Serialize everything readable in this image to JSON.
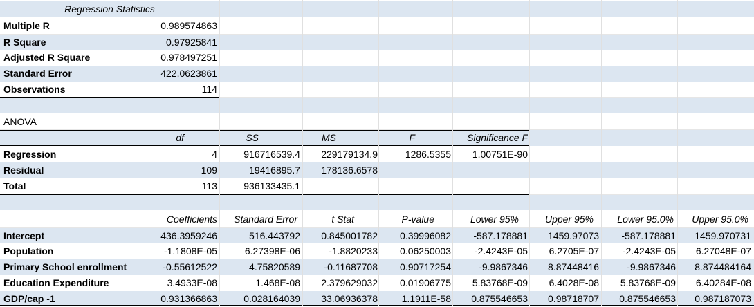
{
  "regression_statistics": {
    "header": "Regression Statistics",
    "rows": [
      {
        "label": "Multiple R",
        "value": "0.989574863"
      },
      {
        "label": "R Square",
        "value": "0.97925841"
      },
      {
        "label": "Adjusted R Square",
        "value": "0.978497251"
      },
      {
        "label": "Standard Error",
        "value": "422.0623861"
      },
      {
        "label": "Observations",
        "value": "114"
      }
    ]
  },
  "anova": {
    "title": "ANOVA",
    "headers": [
      "df",
      "SS",
      "MS",
      "F",
      "Significance F"
    ],
    "rows": [
      {
        "label": "Regression",
        "df": "4",
        "ss": "916716539.4",
        "ms": "229179134.9",
        "f": "1286.5355",
        "sig": "1.00751E-90"
      },
      {
        "label": "Residual",
        "df": "109",
        "ss": "19416895.7",
        "ms": "178136.6578",
        "f": "",
        "sig": ""
      },
      {
        "label": "Total",
        "df": "113",
        "ss": "936133435.1",
        "ms": "",
        "f": "",
        "sig": ""
      }
    ]
  },
  "coefficients": {
    "headers": [
      "Coefficients",
      "Standard Error",
      "t Stat",
      "P-value",
      "Lower 95%",
      "Upper 95%",
      "Lower 95.0%",
      "Upper 95.0%"
    ],
    "rows": [
      {
        "label": "Intercept",
        "values": [
          "436.3959246",
          "516.443792",
          "0.845001782",
          "0.39996082",
          "-587.178881",
          "1459.97073",
          "-587.178881",
          "1459.970731"
        ]
      },
      {
        "label": "Population",
        "values": [
          "-1.1808E-05",
          "6.27398E-06",
          "-1.8820233",
          "0.06250003",
          "-2.4243E-05",
          "6.2705E-07",
          "-2.4243E-05",
          "6.27048E-07"
        ]
      },
      {
        "label": "Primary School enrollment",
        "values": [
          "-0.55612522",
          "4.75820589",
          "-0.11687708",
          "0.90717254",
          "-9.9867346",
          "8.87448416",
          "-9.9867346",
          "8.874484164"
        ]
      },
      {
        "label": "Education Expenditure",
        "values": [
          "3.4933E-08",
          "1.468E-08",
          "2.379629032",
          "0.01906775",
          "5.83768E-09",
          "6.4028E-08",
          "5.83768E-09",
          "6.40284E-08"
        ]
      },
      {
        "label": "GDP/cap -1",
        "values": [
          "0.931366863",
          "0.028164039",
          "33.06936378",
          "1.1911E-58",
          "0.875546653",
          "0.98718707",
          "0.875546653",
          "0.987187073"
        ]
      }
    ]
  }
}
